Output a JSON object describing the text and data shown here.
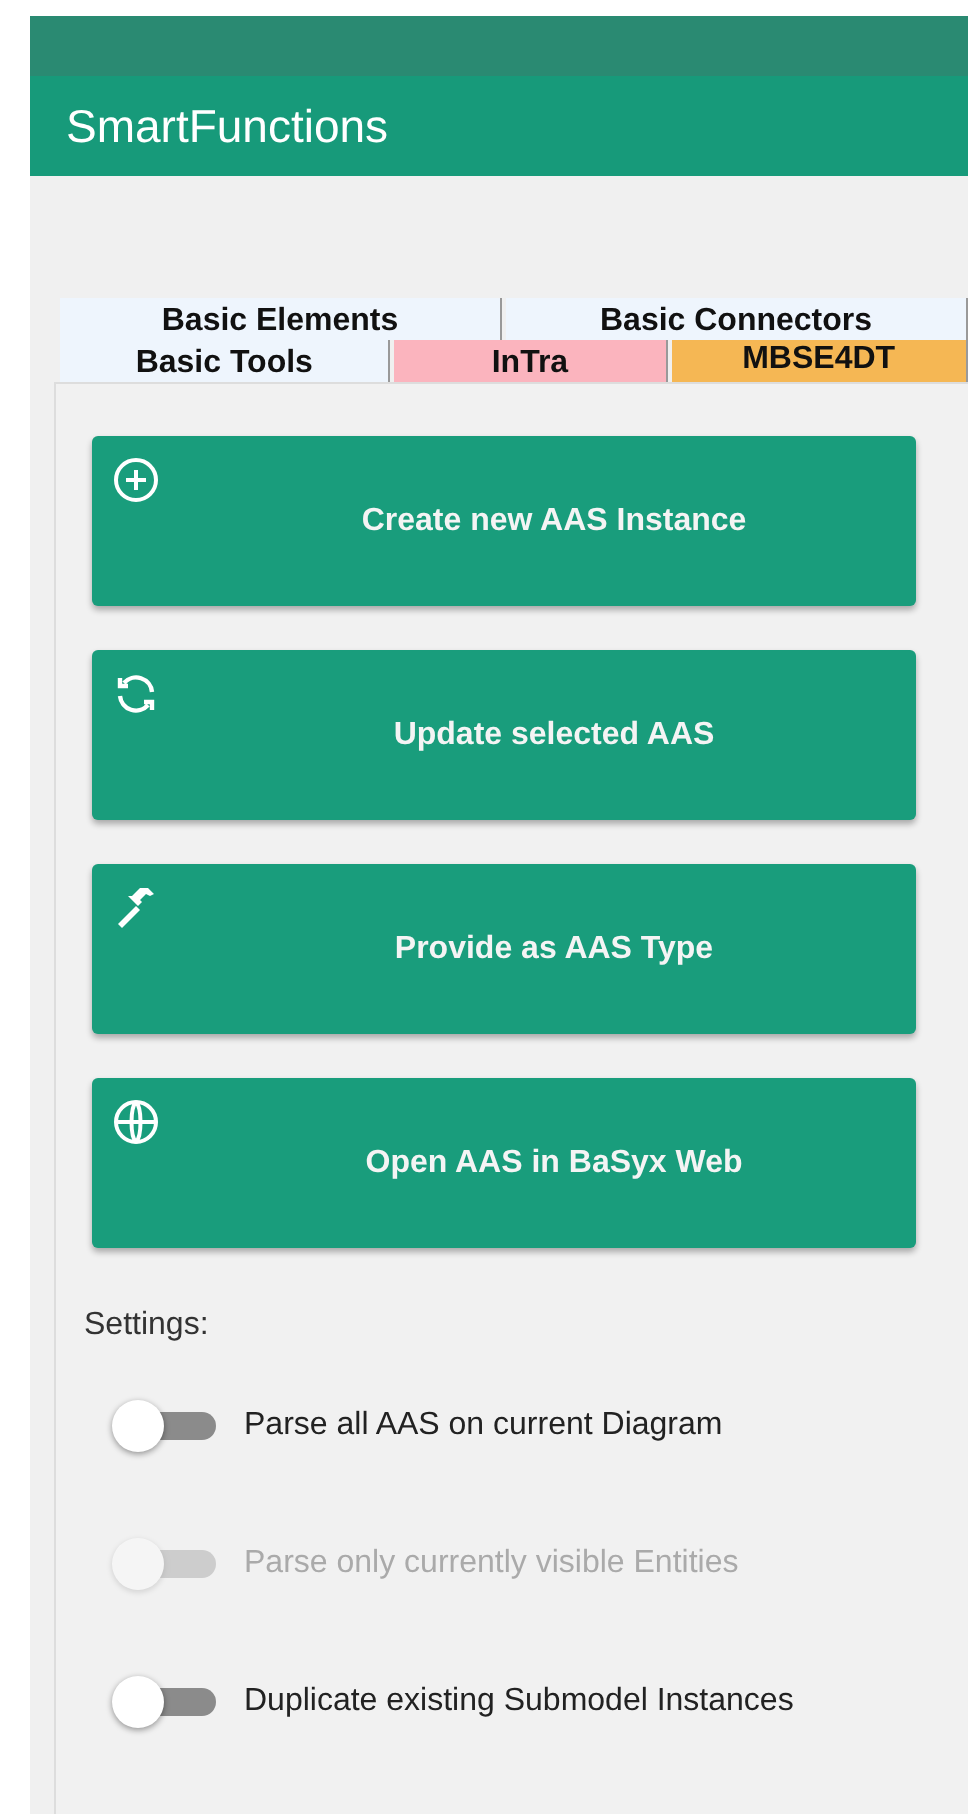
{
  "panel": {
    "title": "SmartFunctions"
  },
  "tab_rows": [
    [
      {
        "label": "Basic Elements",
        "selected": false,
        "color": "#eef5fd"
      },
      {
        "label": "Basic Connectors",
        "selected": false,
        "color": "#eef5fd"
      }
    ],
    [
      {
        "label": "Basic Tools",
        "selected": false,
        "color": "#eef5fd"
      },
      {
        "label": "InTra",
        "selected": false,
        "color": "#fbb4be"
      },
      {
        "label": "MBSE4DT",
        "selected": true,
        "color": "#f5b754"
      }
    ]
  ],
  "actions": [
    {
      "label": "Create new AAS Instance"
    },
    {
      "label": "Update selected AAS"
    },
    {
      "label": "Provide as AAS Type"
    },
    {
      "label": "Open AAS in BaSyx Web"
    }
  ],
  "settings": {
    "heading": "Settings:",
    "toggles": [
      {
        "label": "Parse all AAS on current Diagram",
        "on": false,
        "disabled": false
      },
      {
        "label": "Parse only currently visible Entities",
        "on": false,
        "disabled": true
      },
      {
        "label": "Duplicate existing Submodel Instances",
        "on": false,
        "disabled": false
      }
    ]
  }
}
